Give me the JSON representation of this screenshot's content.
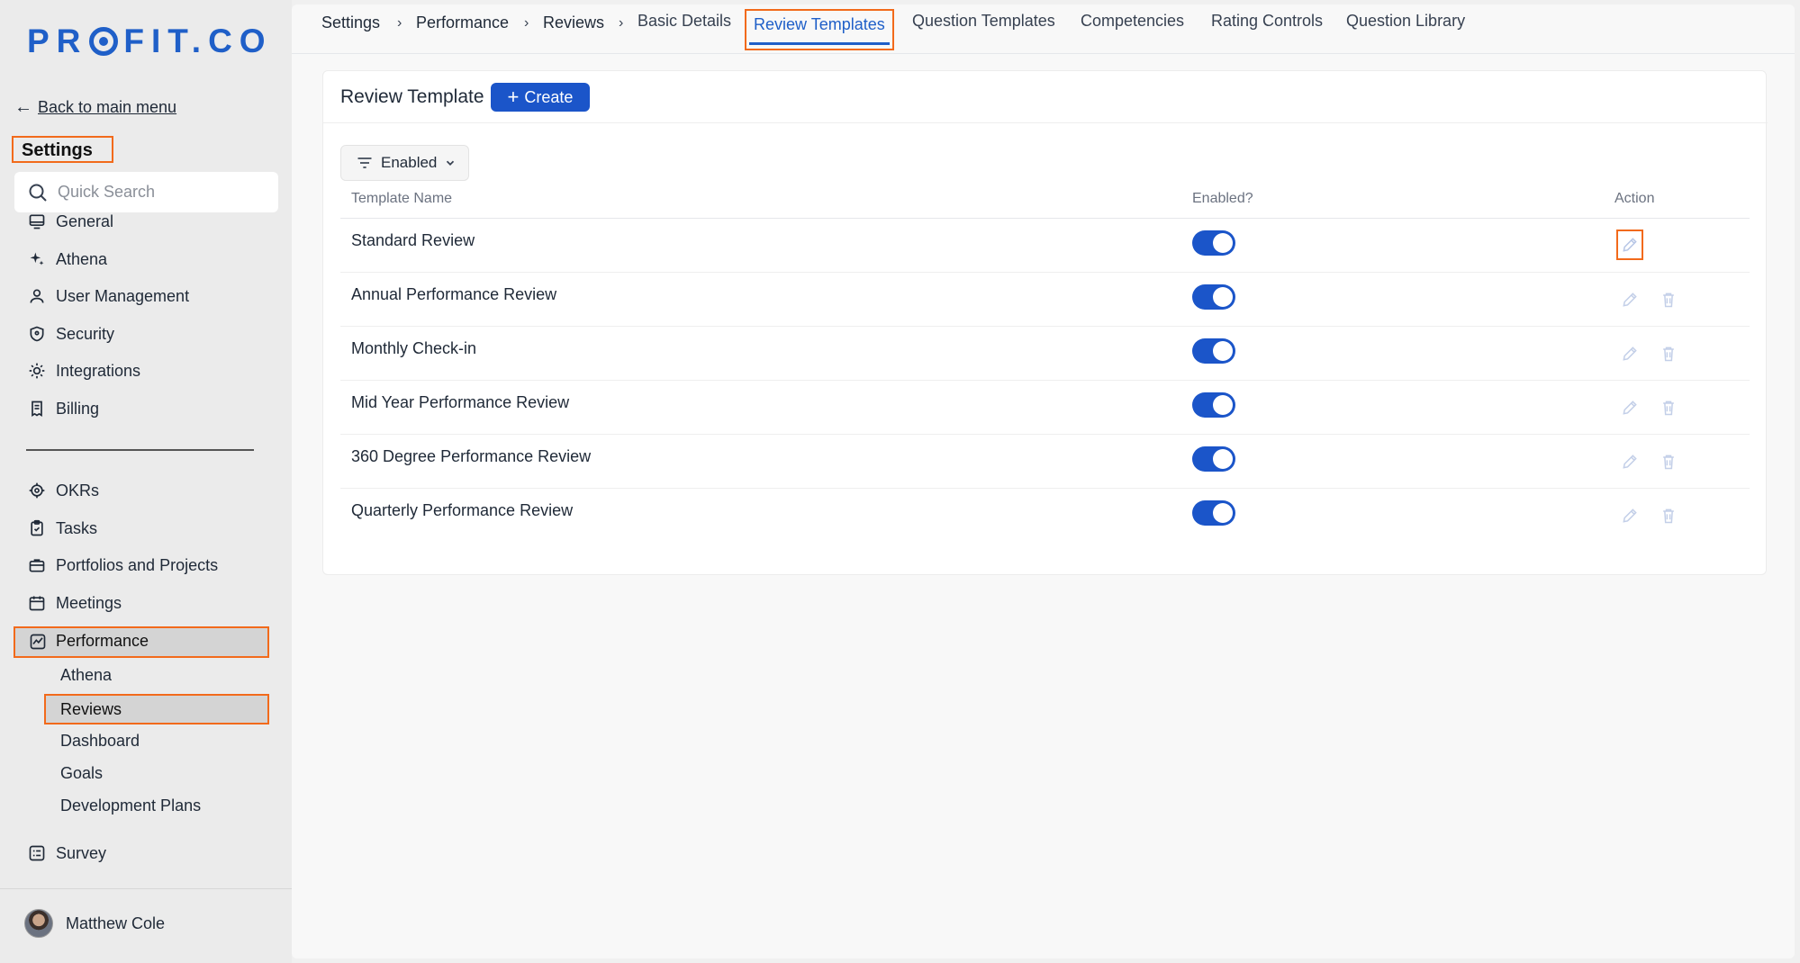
{
  "logo": "PROFIT.CO",
  "sidebar": {
    "back_label": "Back to main menu",
    "title": "Settings",
    "search_placeholder": "Quick Search",
    "items": [
      {
        "label": "General",
        "icon": "monitor-icon"
      },
      {
        "label": "Athena",
        "icon": "sparkle-icon"
      },
      {
        "label": "User Management",
        "icon": "user-icon"
      },
      {
        "label": "Security",
        "icon": "shield-icon"
      },
      {
        "label": "Integrations",
        "icon": "gear-icon"
      },
      {
        "label": "Billing",
        "icon": "receipt-icon"
      }
    ],
    "modules": [
      {
        "label": "OKRs",
        "icon": "target-icon"
      },
      {
        "label": "Tasks",
        "icon": "clipboard-check-icon"
      },
      {
        "label": "Portfolios and Projects",
        "icon": "briefcase-icon"
      },
      {
        "label": "Meetings",
        "icon": "calendar-icon"
      },
      {
        "label": "Performance",
        "icon": "chart-line-icon"
      }
    ],
    "performance_sub": [
      "Athena",
      "Reviews",
      "Dashboard",
      "Goals",
      "Development Plans"
    ],
    "survey_label": "Survey",
    "user_name": "Matthew Cole"
  },
  "breadcrumb": [
    "Settings",
    "Performance",
    "Reviews"
  ],
  "tabs": [
    "Basic Details",
    "Review Templates",
    "Question Templates",
    "Competencies",
    "Rating Controls",
    "Question Library"
  ],
  "active_tab": "Review Templates",
  "card": {
    "title": "Review Template",
    "create_label": "Create",
    "filter_label": "Enabled",
    "columns": [
      "Template Name",
      "Enabled?",
      "Action"
    ],
    "rows": [
      {
        "name": "Standard Review",
        "enabled": true
      },
      {
        "name": "Annual Performance Review",
        "enabled": true
      },
      {
        "name": "Monthly Check-in",
        "enabled": true
      },
      {
        "name": "Mid Year Performance Review",
        "enabled": true
      },
      {
        "name": "360 Degree Performance Review",
        "enabled": true
      },
      {
        "name": "Quarterly Performance Review",
        "enabled": true
      }
    ]
  },
  "colors": {
    "brand": "#1f5fc8",
    "primary_button": "#1b55c9",
    "highlight": "#f26a1b"
  }
}
